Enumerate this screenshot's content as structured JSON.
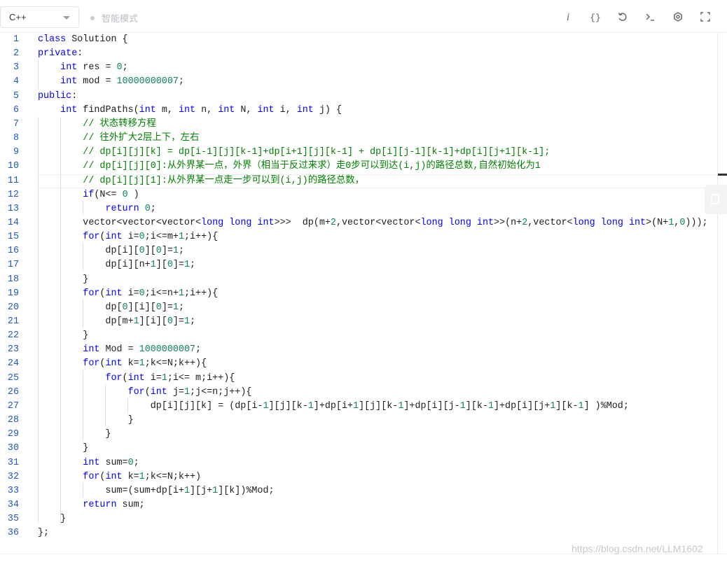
{
  "toolbar": {
    "language": "C++",
    "mode_label": "智能模式",
    "icons": [
      "info-icon",
      "braces-icon",
      "undo-icon",
      "terminal-icon",
      "settings-icon",
      "fullscreen-icon"
    ],
    "info_glyph": "i",
    "braces_glyph": "{}"
  },
  "editor": {
    "line_numbers": [
      "1",
      "2",
      "3",
      "4",
      "5",
      "6",
      "7",
      "8",
      "9",
      "10",
      "11",
      "12",
      "13",
      "14",
      "15",
      "16",
      "17",
      "18",
      "19",
      "20",
      "21",
      "22",
      "23",
      "24",
      "25",
      "26",
      "27",
      "28",
      "29",
      "30",
      "31",
      "32",
      "33",
      "34",
      "35",
      "36"
    ],
    "lines": [
      "class Solution {",
      "private:",
      "    int res = 0;",
      "    int mod = 10000000007;",
      "public:",
      "    int findPaths(int m, int n, int N, int i, int j) {",
      "        // 状态转移方程",
      "        // 往外扩大2层上下，左右",
      "        // dp[i][j][k] = dp[i-1][j][k-1]+dp[i+1][j][k-1] + dp[i][j-1][k-1]+dp[i][j+1][k-1];",
      "        // dp[i][j][0]:从外界某一点，外界（相当于反过来求）走0步可以到达(i,j)的路径总数,自然初始化为1",
      "        // dp[i][j][1]:从外界某一点走一步可以到(i,j)的路径总数，",
      "        if(N<= 0 )",
      "            return 0;",
      "        vector<vector<vector<long long int>>>  dp(m+2,vector<vector<long long int>>(n+2,vector<long long int>(N+1,0)));",
      "        for(int i=0;i<=m+1;i++){",
      "            dp[i][0][0]=1;",
      "            dp[i][n+1][0]=1;",
      "        }",
      "        for(int i=0;i<=n+1;i++){",
      "            dp[0][i][0]=1;",
      "            dp[m+1][i][0]=1;",
      "        }",
      "        int Mod = 1000000007;",
      "        for(int k=1;k<=N;k++){",
      "            for(int i=1;i<= m;i++){",
      "                for(int j=1;j<=n;j++){",
      "                    dp[i][j][k] = (dp[i-1][j][k-1]+dp[i+1][j][k-1]+dp[i][j-1][k-1]+dp[i][j+1][k-1] )%Mod;",
      "                }",
      "            }",
      "        }",
      "        int sum=0;",
      "        for(int k=1;k<=N;k++)",
      "            sum=(sum+dp[i+1][j+1][k])%Mod;",
      "        return sum;",
      "    }",
      "};"
    ],
    "current_line": 11
  },
  "watermark": "https://blog.csdn.net/LLM1602",
  "colors": {
    "keyword": "#0000ff",
    "number": "#098658",
    "comment": "#008000",
    "line_number": "#1f5ab4",
    "text": "#1e1e1e"
  }
}
